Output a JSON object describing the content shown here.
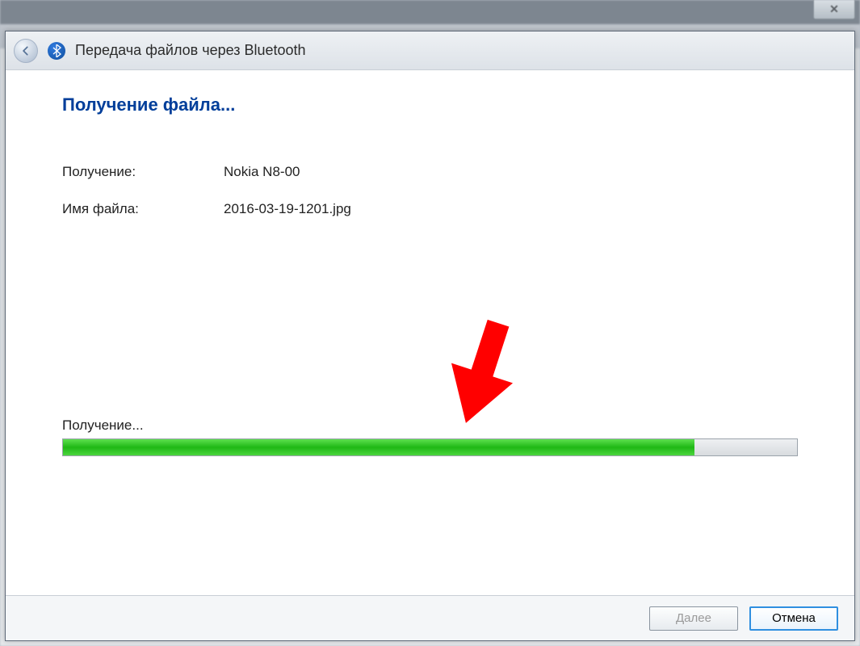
{
  "background": {
    "close_glyph": "✕"
  },
  "wizard": {
    "title": "Передача файлов через Bluetooth",
    "heading": "Получение файла...",
    "rows": {
      "receive_label": "Получение:",
      "receive_value": "Nokia N8-00",
      "filename_label": "Имя файла:",
      "filename_value": "2016-03-19-1201.jpg"
    },
    "progress": {
      "label": "Получение...",
      "percent": 86
    },
    "buttons": {
      "next": "Далее",
      "cancel": "Отмена"
    }
  },
  "annotation": {
    "arrow_color": "#ff0000"
  }
}
